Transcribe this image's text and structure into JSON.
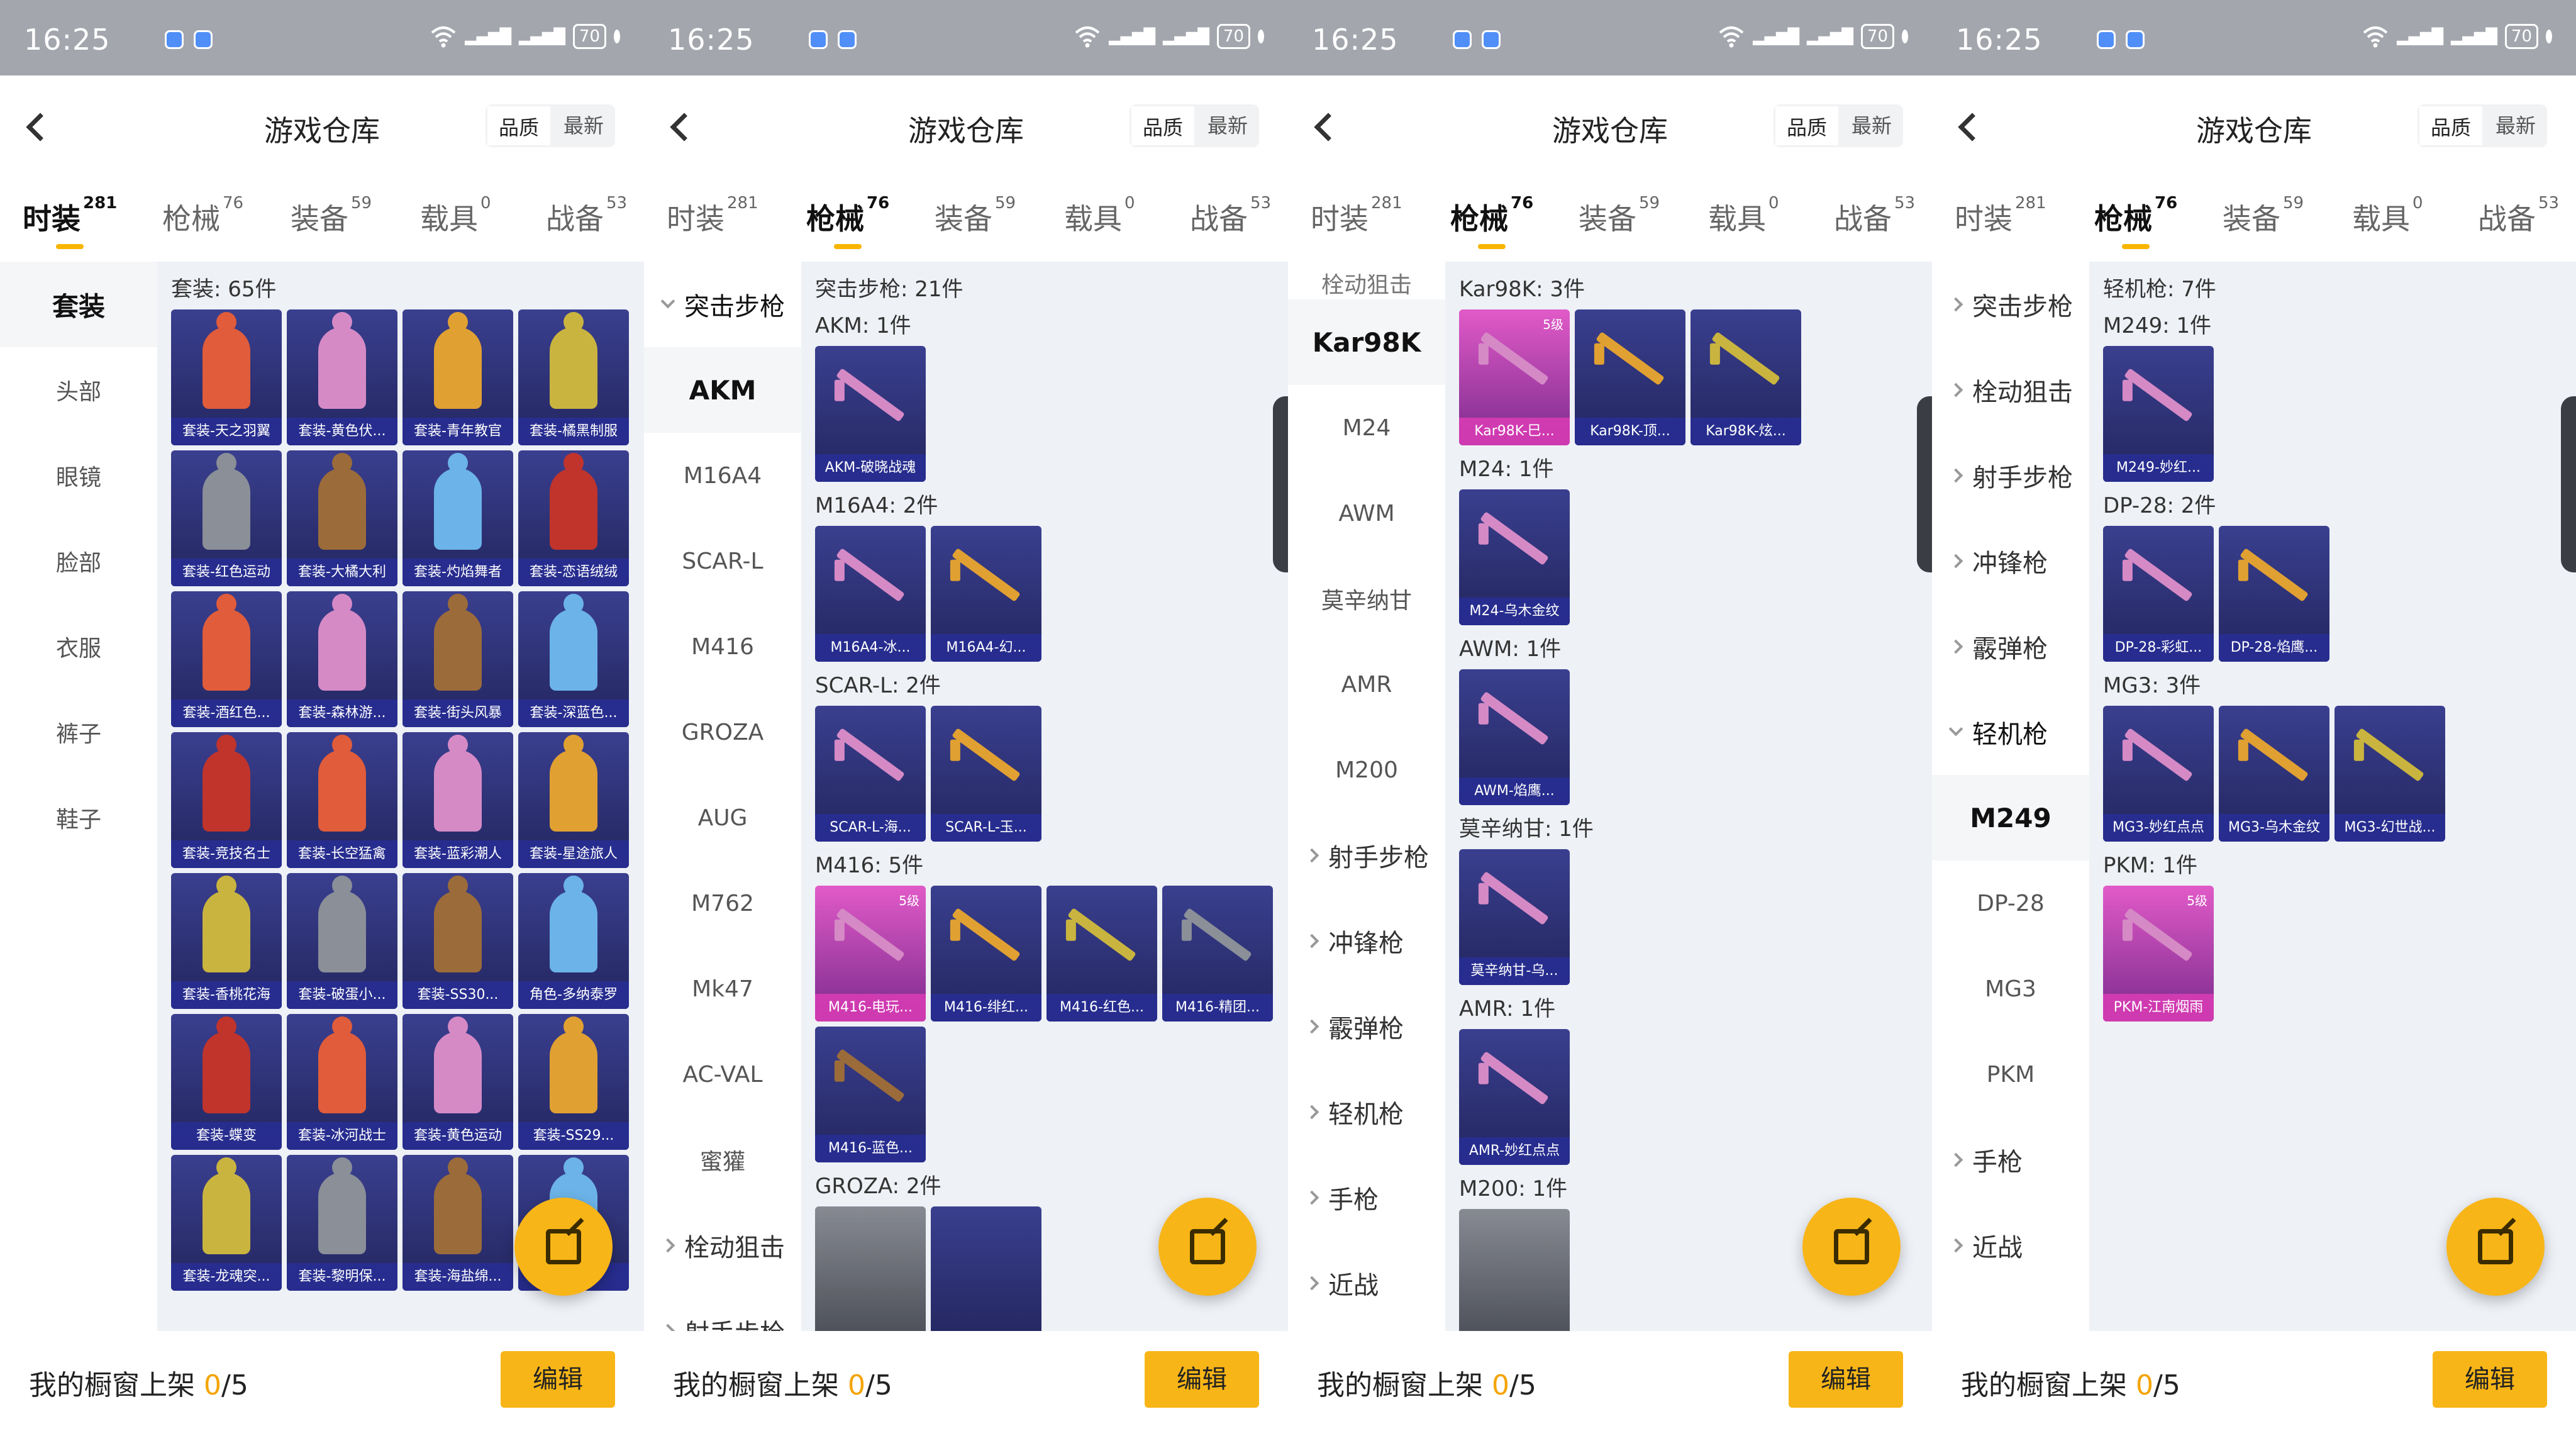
{
  "status": {
    "time": "16:25",
    "battery": "70"
  },
  "header": {
    "title": "游戏仓库",
    "sort_quality": "品质",
    "sort_latest": "最新"
  },
  "categories": [
    {
      "name": "时装",
      "count": "281"
    },
    {
      "name": "枪械",
      "count": "76"
    },
    {
      "name": "装备",
      "count": "59"
    },
    {
      "name": "载具",
      "count": "0"
    },
    {
      "name": "战备",
      "count": "53"
    }
  ],
  "footer": {
    "label": "我的橱窗上架",
    "count": "0",
    "total": "/5",
    "edit": "编辑"
  },
  "screens": [
    {
      "sidebar": [
        "套装",
        "头部",
        "眼镜",
        "脸部",
        "衣服",
        "裤子",
        "鞋子"
      ],
      "section": "套装: 65件",
      "items": [
        "套装-天之羽翼",
        "套装-黄色伏...",
        "套装-青年教官",
        "套装-橘黑制服",
        "套装-红色运动",
        "套装-大橘大利",
        "套装-灼焰舞者",
        "套装-恋语绒绒",
        "套装-酒红色...",
        "套装-森林游...",
        "套装-街头风暴",
        "套装-深蓝色...",
        "套装-竞技名士",
        "套装-长空猛禽",
        "套装-蓝彩潮人",
        "套装-星途旅人",
        "套装-香桃花海",
        "套装-破蛋小...",
        "套装-SS30...",
        "角色-多纳泰罗",
        "套装-蝶变",
        "套装-冰河战士",
        "套装-黄色运动",
        "套装-SS29...",
        "套装-龙魂突...",
        "套装-黎明保...",
        "套装-海盐绵...",
        ""
      ]
    },
    {
      "sidebar": [
        "突击步枪",
        "AKM",
        "M16A4",
        "SCAR-L",
        "M416",
        "GROZA",
        "AUG",
        "M762",
        "Mk47",
        "AC-VAL",
        "蜜獾",
        "栓动狙击",
        "射手步枪"
      ],
      "sections": [
        {
          "title": "突击步枪: 21件"
        },
        {
          "title": "AKM: 1件",
          "items": [
            "AKM-破晓战魂"
          ]
        },
        {
          "title": "M16A4: 2件",
          "items": [
            "M16A4-冰...",
            "M16A4-幻..."
          ]
        },
        {
          "title": "SCAR-L: 2件",
          "items": [
            "SCAR-L-海...",
            "SCAR-L-玉..."
          ]
        },
        {
          "title": "M416: 5件",
          "items": [
            "M416-电玩...",
            "M416-绯红...",
            "M416-红色...",
            "M416-精团...",
            "M416-蓝色..."
          ],
          "level": "5级"
        },
        {
          "title": "GROZA: 2件"
        }
      ]
    },
    {
      "sidebar": [
        "栓动狙击",
        "Kar98K",
        "M24",
        "AWM",
        "莫辛纳甘",
        "AMR",
        "M200",
        "射手步枪",
        "冲锋枪",
        "霰弹枪",
        "轻机枪",
        "手枪",
        "近战"
      ],
      "sections": [
        {
          "title": "Kar98K: 3件",
          "items": [
            "Kar98K-巳...",
            "Kar98K-顶...",
            "Kar98K-炫..."
          ],
          "level": "5级"
        },
        {
          "title": "M24: 1件",
          "items": [
            "M24-乌木金纹"
          ]
        },
        {
          "title": "AWM: 1件",
          "items": [
            "AWM-焰鹰..."
          ]
        },
        {
          "title": "莫辛纳甘: 1件",
          "items": [
            "莫辛纳甘-乌..."
          ]
        },
        {
          "title": "AMR: 1件",
          "items": [
            "AMR-妙红点点"
          ]
        },
        {
          "title": "M200: 1件"
        }
      ]
    },
    {
      "sidebar": [
        "突击步枪",
        "栓动狙击",
        "射手步枪",
        "冲锋枪",
        "霰弹枪",
        "轻机枪",
        "M249",
        "DP-28",
        "MG3",
        "PKM",
        "手枪",
        "近战"
      ],
      "sections": [
        {
          "title": "轻机枪: 7件"
        },
        {
          "title": "M249: 1件",
          "items": [
            "M249-妙红..."
          ]
        },
        {
          "title": "DP-28: 2件",
          "items": [
            "DP-28-彩虹...",
            "DP-28-焰鹰..."
          ]
        },
        {
          "title": "MG3: 3件",
          "items": [
            "MG3-妙红点点",
            "MG3-乌木金纹",
            "MG3-幻世战..."
          ]
        },
        {
          "title": "PKM: 1件",
          "items": [
            "PKM-江南烟雨"
          ],
          "level": "5级"
        }
      ]
    }
  ]
}
